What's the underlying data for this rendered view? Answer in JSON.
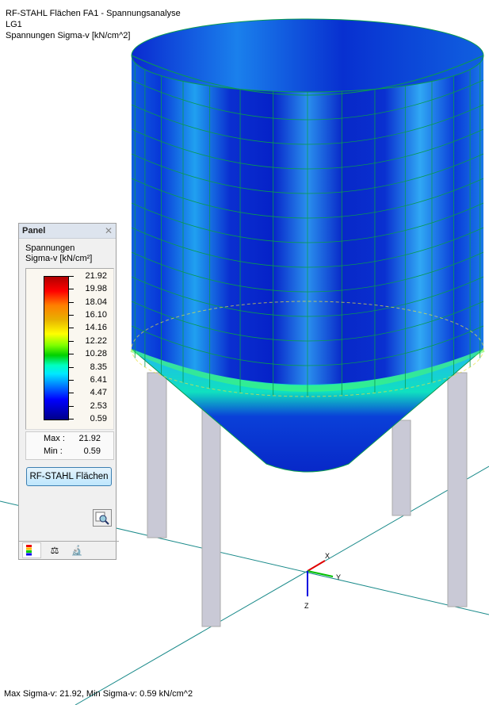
{
  "header": {
    "line1": "RF-STAHL Flächen FA1 - Spannungsanalyse",
    "line2": "LG1",
    "line3": "Spannungen Sigma-v [kN/cm^2]"
  },
  "panel": {
    "title": "Panel",
    "label1": "Spannungen",
    "label2": "Sigma-v [kN/cm²]",
    "legend_values": [
      "21.92",
      "19.98",
      "18.04",
      "16.10",
      "14.16",
      "12.22",
      "10.28",
      "8.35",
      "6.41",
      "4.47",
      "2.53",
      "0.59"
    ],
    "max_label": "Max :",
    "max_value": "21.92",
    "min_label": "Min :",
    "min_value": "0.59",
    "button": "RF-STAHL Flächen",
    "tabs": [
      "color-scale-icon",
      "balance-icon",
      "microscope-icon"
    ]
  },
  "axes": {
    "x": "X",
    "y": "Y",
    "z": "Z"
  },
  "footer": "Max Sigma-v: 21.92, Min Sigma-v: 0.59 kN/cm^2",
  "colors": {
    "axis_line": "#1a8a8a",
    "x_axis": "#e00000",
    "y_axis": "#00c000",
    "z_axis": "#0000e0",
    "leg": "#c9c9d6"
  }
}
